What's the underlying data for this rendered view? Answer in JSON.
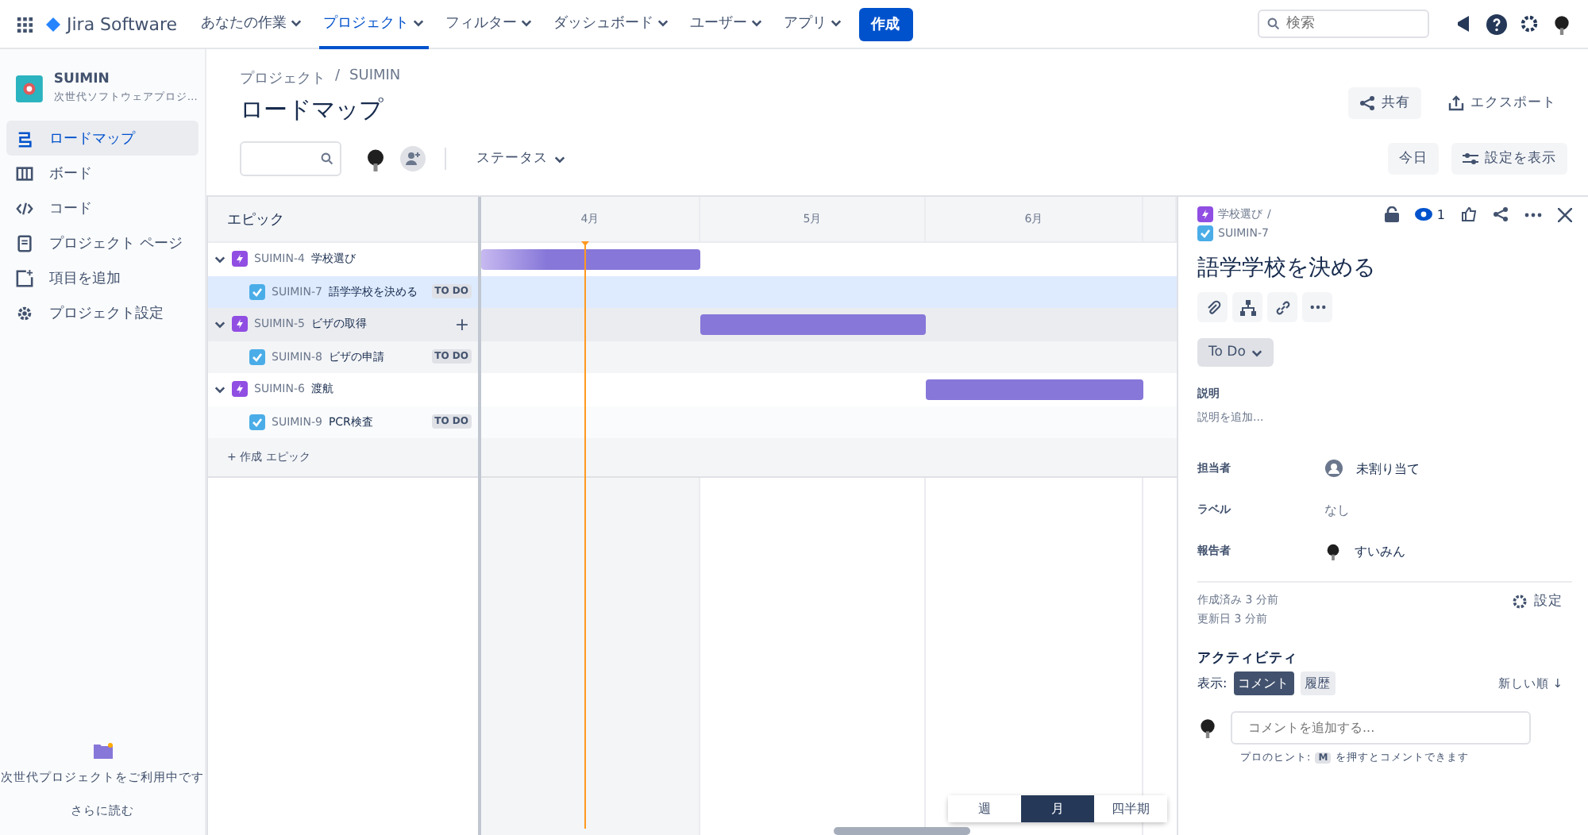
{
  "topnav": {
    "product": "Jira Software",
    "menus": [
      {
        "label": "あなたの作業",
        "selected": false
      },
      {
        "label": "プロジェクト",
        "selected": true
      },
      {
        "label": "フィルター",
        "selected": false
      },
      {
        "label": "ダッシュボード",
        "selected": false
      },
      {
        "label": "ユーザー",
        "selected": false
      },
      {
        "label": "アプリ",
        "selected": false
      }
    ],
    "create": "作成",
    "search": {
      "placeholder": "検索"
    }
  },
  "sidebar": {
    "project": {
      "name": "SUIMIN",
      "type": "次世代ソフトウェアプロジ…"
    },
    "items": [
      {
        "kind": "roadmap",
        "label": "ロードマップ",
        "selected": true
      },
      {
        "kind": "board",
        "label": "ボード",
        "selected": false
      },
      {
        "kind": "code",
        "label": "コード",
        "selected": false
      },
      {
        "kind": "page",
        "label": "プロジェクト ページ",
        "selected": false
      },
      {
        "kind": "add",
        "label": "項目を追加",
        "selected": false
      },
      {
        "kind": "settings",
        "label": "プロジェクト設定",
        "selected": false
      }
    ],
    "footer": {
      "text": "次世代プロジェクトをご利用中です",
      "link": "さらに読む"
    }
  },
  "page": {
    "breadcrumb": [
      "プロジェクト",
      "SUIMIN"
    ],
    "breadcrumb_separator": "/",
    "title": "ロードマップ",
    "share": "共有",
    "export": "エクスポート",
    "status_filter": "ステータス",
    "today": "今日",
    "view_settings": "設定を表示"
  },
  "roadmap": {
    "epic_header": "エピック",
    "months": [
      "4月",
      "5月",
      "6月"
    ],
    "epics": [
      {
        "key": "SUIMIN-4",
        "title": "学校選び",
        "expanded": true,
        "hovered": false,
        "bar": [
          true,
          false,
          false
        ],
        "children": [
          {
            "key": "SUIMIN-7",
            "title": "語学学校を決める",
            "status": "TO DO",
            "selected": true
          }
        ]
      },
      {
        "key": "SUIMIN-5",
        "title": "ビザの取得",
        "expanded": true,
        "hovered": true,
        "bar": [
          false,
          true,
          false
        ],
        "children": [
          {
            "key": "SUIMIN-8",
            "title": "ビザの申請",
            "status": "TO DO",
            "selected": false
          }
        ]
      },
      {
        "key": "SUIMIN-6",
        "title": "渡航",
        "expanded": true,
        "hovered": false,
        "bar": [
          false,
          false,
          true
        ],
        "children": [
          {
            "key": "SUIMIN-9",
            "title": "PCR検査",
            "status": "TO DO",
            "selected": false
          }
        ]
      }
    ],
    "create_epic": "+ 作成 エピック",
    "add_child": "+",
    "zoom": [
      {
        "label": "週",
        "selected": false
      },
      {
        "label": "月",
        "selected": true
      },
      {
        "label": "四半期",
        "selected": false
      }
    ]
  },
  "issue": {
    "parent": "学校選び",
    "separator": "/",
    "key": "SUIMIN-7",
    "watchers": "1",
    "title": "語学学校を決める",
    "status": "To Do",
    "description_label": "説明",
    "description_placeholder": "説明を追加...",
    "fields": [
      {
        "kind": "person",
        "label": "担当者",
        "value": "未割り当て"
      },
      {
        "kind": "text",
        "label": "ラベル",
        "value": "なし"
      },
      {
        "kind": "avatar",
        "label": "報告者",
        "value": "すいみん"
      }
    ],
    "created": "作成済み 3 分前",
    "updated": "更新日 3 分前",
    "settings": "設定",
    "activity": "アクティビティ",
    "show": "表示:",
    "tabs": [
      {
        "label": "コメント",
        "selected": true
      },
      {
        "label": "履歴",
        "selected": false
      }
    ],
    "sort": "新しい順 ↓",
    "comment": {
      "placeholder": "コメントを追加する..."
    },
    "hint_prefix": "プロのヒント:",
    "hint_key": "M",
    "hint_suffix": "を押すとコメントできます"
  }
}
